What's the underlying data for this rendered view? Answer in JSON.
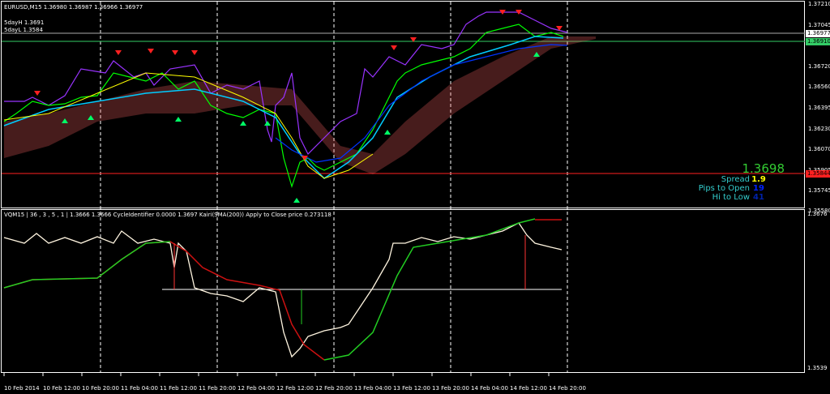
{
  "main_pane": {
    "symbol_line": "EURUSD,M15  1.36980 1.36987 1.36966 1.36977",
    "day_high": "5dayH 1.3691",
    "day_low": "5dayL 1.3584",
    "price_axis": [
      "1.37210",
      "1.37045",
      "1.36720",
      "1.36560",
      "1.36395",
      "1.36230",
      "1.36070",
      "1.35905",
      "1.35745",
      "1.35580"
    ],
    "bid_label": "1.36977",
    "green_line_label": "1.36910",
    "red_line_label": "1.35844",
    "current_price": "1.3698",
    "spread_label": "Spread",
    "spread_value": "1.9",
    "pips_to_open_label": "Pips to Open",
    "pips_to_open_value": "19",
    "hi_to_low_label": "Hi to Low",
    "hi_to_low_value": "41"
  },
  "indicator_pane": {
    "header": "VQM15 | 36 , 3 , 5 , 1 | 1.3666 1.3666  CycleIdentifier 0.0000 1.3697  Kairi(SMA(200)) Apply to Close price 0.273118",
    "axis_top": "1.3676",
    "axis_bottom": "1.3539"
  },
  "time_axis": [
    "10 Feb 2014",
    "10 Feb 12:00",
    "10 Feb 20:00",
    "11 Feb 04:00",
    "11 Feb 12:00",
    "11 Feb 20:00",
    "12 Feb 04:00",
    "12 Feb 12:00",
    "12 Feb 20:00",
    "13 Feb 04:00",
    "13 Feb 12:00",
    "13 Feb 20:00",
    "14 Feb 04:00",
    "14 Feb 12:00",
    "14 Feb 20:00"
  ],
  "colors": {
    "bull": "#00ff00",
    "bear": "#ff0000",
    "purple": "#9933ff",
    "cyan": "#00ccff",
    "yellow": "#ffff00",
    "ichimoku": "#ff6666"
  }
}
